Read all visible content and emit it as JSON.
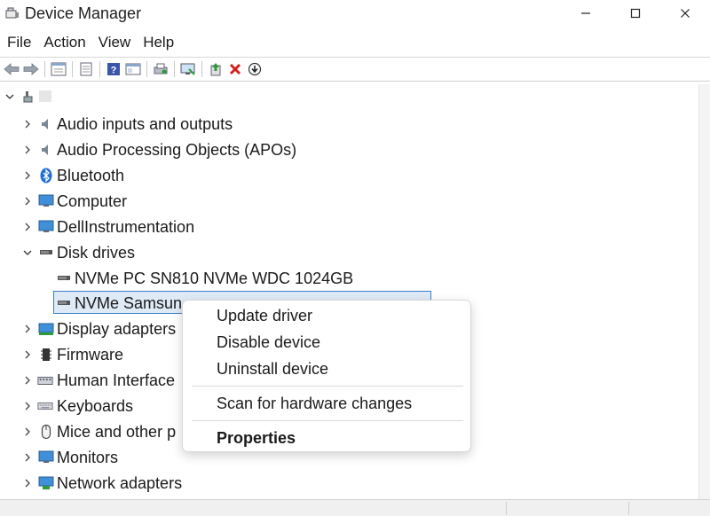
{
  "window": {
    "title": "Device Manager",
    "minimize": "—",
    "maximize": "☐",
    "close": "✕"
  },
  "menu": [
    "File",
    "Action",
    "View",
    "Help"
  ],
  "toolbar": {
    "icons": [
      "back-arrow-icon",
      "forward-arrow-icon",
      "properties-icon",
      "update-driver-icon",
      "help-icon",
      "view-icon",
      "print-icon",
      "scan-hardware-icon",
      "add-driver-icon",
      "uninstall-icon",
      "download-icon"
    ]
  },
  "tree": {
    "root": {
      "label": "",
      "expanded": true
    },
    "categories": [
      {
        "label": "Audio inputs and outputs",
        "expanded": false
      },
      {
        "label": "Audio Processing Objects (APOs)",
        "expanded": false
      },
      {
        "label": "Bluetooth",
        "expanded": false
      },
      {
        "label": "Computer",
        "expanded": false
      },
      {
        "label": "DellInstrumentation",
        "expanded": false
      },
      {
        "label": "Disk drives",
        "expanded": true
      },
      {
        "label": "Display adapters",
        "expanded": false
      },
      {
        "label": "Firmware",
        "expanded": false
      },
      {
        "label": "Human Interface",
        "expanded": false
      },
      {
        "label": "Keyboards",
        "expanded": false
      },
      {
        "label": "Mice and other p",
        "expanded": false
      },
      {
        "label": "Monitors",
        "expanded": false
      },
      {
        "label": "Network adapters",
        "expanded": false
      }
    ],
    "disk_drives": [
      {
        "label": "NVMe PC SN810 NVMe WDC 1024GB",
        "selected": false
      },
      {
        "label": "NVMe Samsun",
        "selected": true
      }
    ]
  },
  "context_menu": {
    "items": [
      "Update driver",
      "Disable device",
      "Uninstall device",
      "Scan for hardware changes",
      "Properties"
    ]
  },
  "colors": {
    "selection_border": "#3c7fc7",
    "selection_fill": "#dfeaf7",
    "uninstall_red": "#d0201a",
    "add_green": "#2e9b3a",
    "bluetooth_blue": "#1f6fd6"
  }
}
